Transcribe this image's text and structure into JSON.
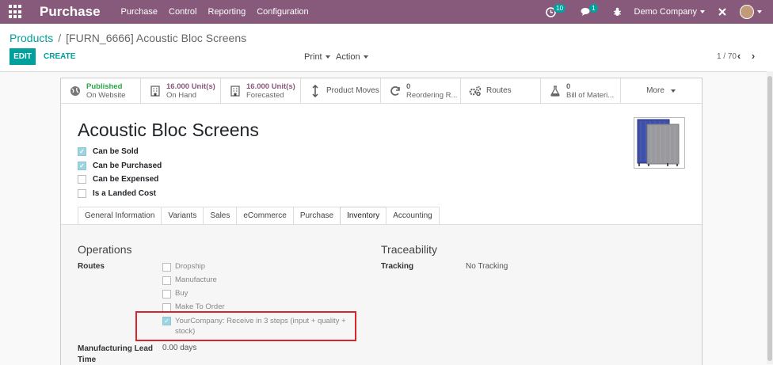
{
  "navbar": {
    "app_title": "Purchase",
    "menu": [
      "Purchase",
      "Control",
      "Reporting",
      "Configuration"
    ],
    "activity_count": "10",
    "messages_count": "1",
    "company": "Demo Company"
  },
  "breadcrumb": {
    "parent": "Products",
    "separator": "/",
    "current": "[FURN_6666] Acoustic Bloc Screens"
  },
  "buttons": {
    "edit": "EDIT",
    "create": "CREATE",
    "print": "Print",
    "action": "Action"
  },
  "pager": {
    "value": "1 / 70"
  },
  "smart_buttons": {
    "published": {
      "line1": "Published",
      "line2": "On Website",
      "icon": "globe-icon"
    },
    "on_hand": {
      "line1": "16.000 Unit(s)",
      "line2": "On Hand",
      "icon": "building-icon"
    },
    "forecasted": {
      "line1": "16.000 Unit(s)",
      "line2": "Forecasted",
      "icon": "building-icon"
    },
    "product_moves": {
      "label": "Product Moves",
      "icon": "arrows-vertical-icon"
    },
    "reordering": {
      "line1": "0",
      "line2": "Reordering R...",
      "icon": "refresh-icon"
    },
    "routes": {
      "label": "Routes",
      "icon": "cogs-icon"
    },
    "bom": {
      "line1": "0",
      "line2": "Bill of Materi...",
      "icon": "flask-icon"
    },
    "more": {
      "label": "More"
    }
  },
  "product": {
    "name": "Acoustic Bloc Screens",
    "flags": [
      {
        "label": "Can be Sold",
        "checked": true
      },
      {
        "label": "Can be Purchased",
        "checked": true
      },
      {
        "label": "Can be Expensed",
        "checked": false
      },
      {
        "label": "Is a Landed Cost",
        "checked": false
      }
    ]
  },
  "tabs": [
    "General Information",
    "Variants",
    "Sales",
    "eCommerce",
    "Purchase",
    "Inventory",
    "Accounting"
  ],
  "active_tab": "Inventory",
  "inventory": {
    "operations_title": "Operations",
    "routes_label": "Routes",
    "routes": [
      {
        "label": "Dropship",
        "checked": false
      },
      {
        "label": "Manufacture",
        "checked": false
      },
      {
        "label": "Buy",
        "checked": false
      },
      {
        "label": "Make To Order",
        "checked": false
      },
      {
        "label_line1": "YourCompany: Receive in 3 steps (input + quality +",
        "label_line2": "stock)",
        "checked": true
      }
    ],
    "mfg_lead_label_line1": "Manufacturing Lead",
    "mfg_lead_label_line2": "Time",
    "mfg_lead_value": "0.00 days",
    "traceability_title": "Traceability",
    "tracking_label": "Tracking",
    "tracking_value": "No Tracking"
  },
  "colors": {
    "navbar": "#875a7b",
    "accent": "#00a09d",
    "highlight": "#d9262c"
  }
}
